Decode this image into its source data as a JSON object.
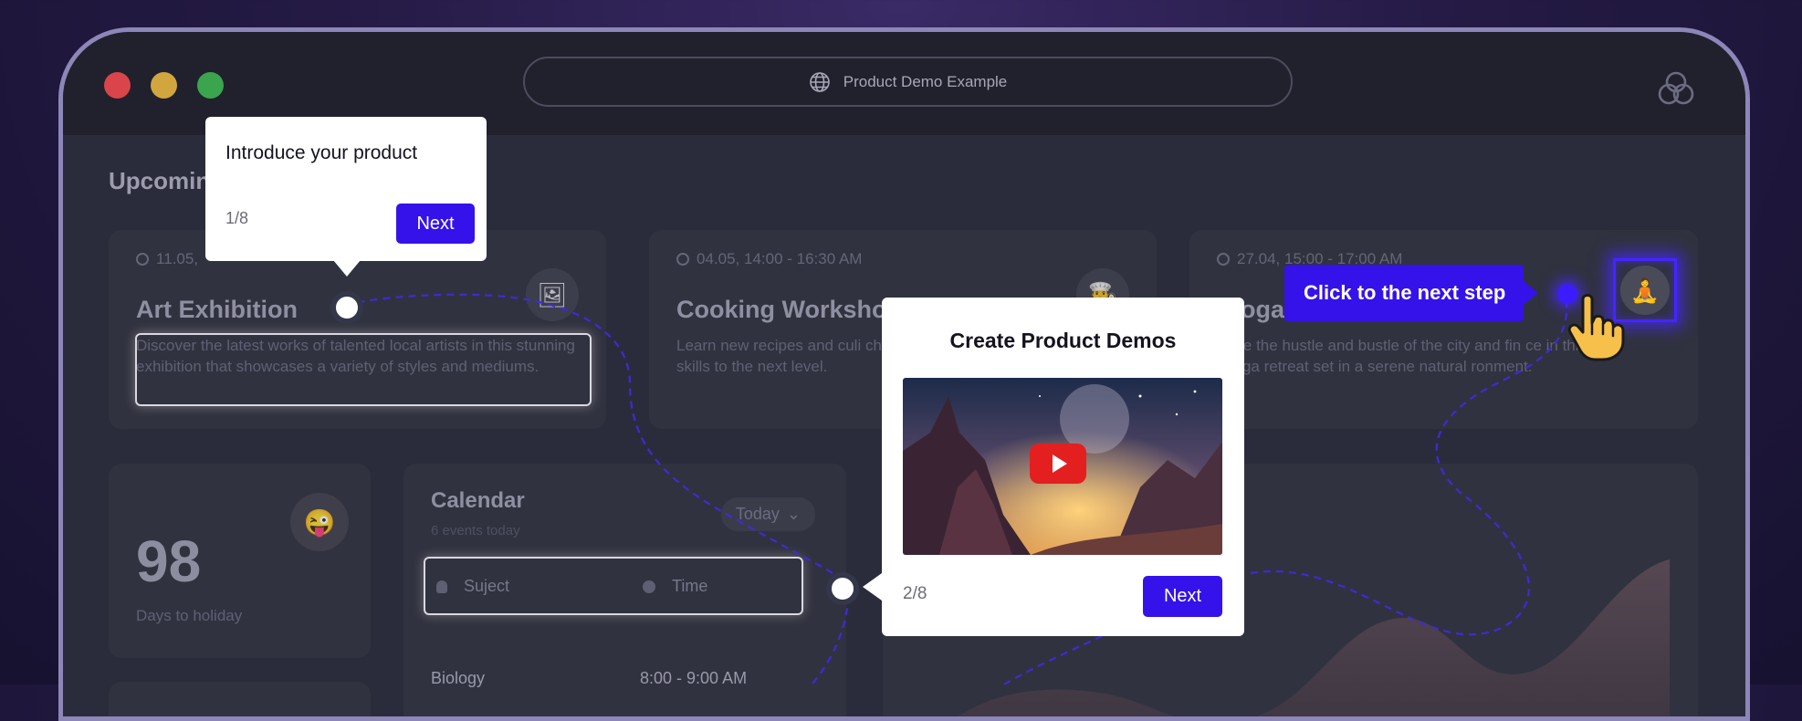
{
  "browser": {
    "url_text": "Product Demo Example"
  },
  "dashboard": {
    "section_title": "Upcoming",
    "events": [
      {
        "date": "11.05,",
        "title": "Art Exhibition",
        "description": "Discover the latest works of talented local artists in this stunning exhibition that showcases a variety of styles and mediums.",
        "icon": "picture-icon"
      },
      {
        "date": "04.05, 14:00 - 16:30 AM",
        "title": "Cooking Worksho",
        "description": "Learn new recipes and culi chefs in this hands-on work skills to the next level.",
        "icon": "chef-icon"
      },
      {
        "date": "27.04, 15:00 - 17:00 AM",
        "title": "Yoga",
        "description": "ape the hustle and bustle of the city and fin ce in this yoga retreat set in a serene natural ronment.",
        "icon": "meditation-icon"
      }
    ],
    "stat": {
      "value": "98",
      "label": "Days to holiday",
      "icon": "winking-face-icon"
    },
    "calendar": {
      "title": "Calendar",
      "subtitle": "6 events today",
      "filter": "Today",
      "columns": [
        "Suject",
        "Time"
      ],
      "rows": [
        {
          "subject": "Biology",
          "time": "8:00 - 9:00 AM"
        }
      ]
    }
  },
  "tour": {
    "step1": {
      "text": "Introduce your product",
      "counter": "1/8",
      "button": "Next"
    },
    "step2": {
      "title": "Create Product Demos",
      "counter": "2/8",
      "button": "Next",
      "video_icon": "play-icon"
    },
    "hint": {
      "text": "Click to the next step",
      "pointer_icon": "pointing-hand-icon"
    }
  },
  "colors": {
    "accent": "#3512ea",
    "panel": "#31323f",
    "titlebar": "#20212d",
    "traffic_red": "#d9454b",
    "traffic_yellow": "#d1a63e",
    "traffic_green": "#3aa54d"
  }
}
